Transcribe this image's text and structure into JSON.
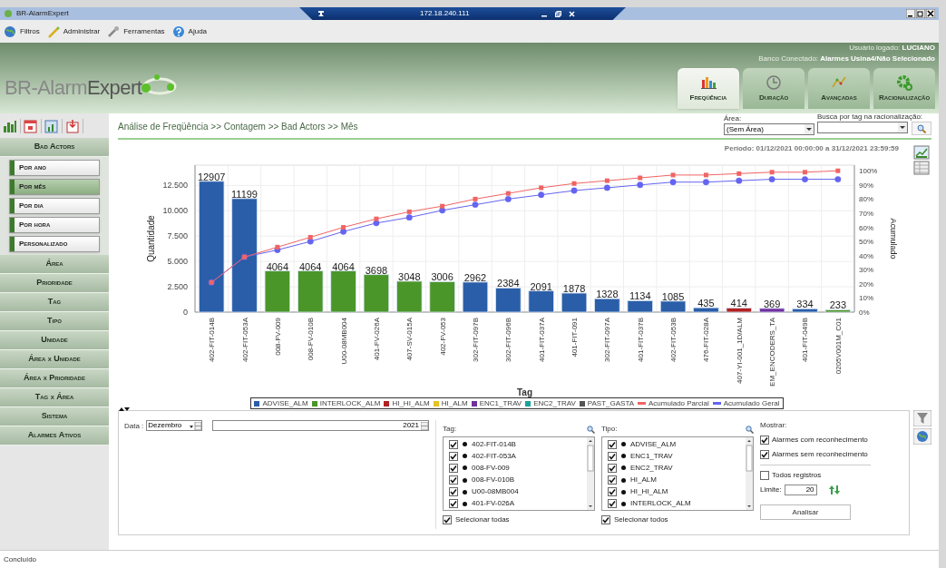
{
  "window": {
    "title": "BR-AlarmExpert",
    "remote_host": "172.18.240.111"
  },
  "menu": [
    {
      "label": "Filtros",
      "kind": "globe"
    },
    {
      "label": "Administrar",
      "kind": "wand"
    },
    {
      "label": "Ferramentas",
      "kind": "wrench"
    },
    {
      "label": "Ajuda",
      "kind": "help"
    }
  ],
  "header": {
    "logo_light": "BR-Alarm",
    "logo_dark": "Expert",
    "user_label": "Usuário logado:",
    "user": "LUCIANO",
    "db_label": "Banco Conectado:",
    "db": "Alarmes Usina4/Não Selecionado",
    "tabs": [
      {
        "label": "Freqüência",
        "kind": "bars",
        "selected": true
      },
      {
        "label": "Duração",
        "kind": "clock",
        "selected": false
      },
      {
        "label": "Avançadas",
        "kind": "trend",
        "selected": false
      },
      {
        "label": "Racionalização",
        "kind": "gear",
        "selected": false
      }
    ]
  },
  "sidebar": {
    "groups": [
      {
        "label": "Bad Actors",
        "children": [
          {
            "label": "Por ano",
            "selected": false
          },
          {
            "label": "Por mês",
            "selected": true
          },
          {
            "label": "Por dia",
            "selected": false
          },
          {
            "label": "Por hora",
            "selected": false
          },
          {
            "label": "Personalizado",
            "selected": false
          }
        ]
      },
      {
        "label": "Área"
      },
      {
        "label": "Prioridade"
      },
      {
        "label": "Tag"
      },
      {
        "label": "Tipo"
      },
      {
        "label": "Unidade"
      },
      {
        "label": "Área x Unidade"
      },
      {
        "label": "Área x Prioridade"
      },
      {
        "label": "Tag x Área"
      },
      {
        "label": "Sistema"
      },
      {
        "label": "Alarmes Ativos"
      }
    ]
  },
  "breadcrumb": "Análise de Freqüência >> Contagem >> Bad Actors >> Mês",
  "area_filter": {
    "label": "Área:",
    "value": "(Sem Área)"
  },
  "search": {
    "label": "Busca por tag na racionalização:"
  },
  "chart": {
    "period": "Período: 01/12/2021 00:00:00 a 31/12/2021 23:59:59",
    "chart_data": {
      "type": "bar",
      "xlabel": "Tag",
      "ylabel": "Quantidade",
      "grid": true,
      "categories": [
        "402-FIT-014B",
        "402-FIT-053A",
        "008-FV-009",
        "008-FV-010B",
        "U00-08MB004",
        "401-FV-026A",
        "407-SV-015A",
        "402-FV-053",
        "302-FIT-097B",
        "302-FIT-096B",
        "401-FIT-037A",
        "401-FIT-091",
        "302-FIT-097A",
        "401-FIT-037B",
        "402-FIT-053B",
        "476-FIT-028A",
        "407-YI-001_1D/ALM",
        "EM_ENCODERS_TA",
        "401-FIT-049B",
        "0205V001M_C01"
      ],
      "ylim": [
        0,
        14500
      ],
      "yticks": [
        {
          "value": 0,
          "label": "0"
        },
        {
          "value": 2500,
          "label": "2.500"
        },
        {
          "value": 5000,
          "label": "5.000"
        },
        {
          "value": 7500,
          "label": "7.500"
        },
        {
          "value": 10000,
          "label": "10.000"
        },
        {
          "value": 12500,
          "label": "12.500"
        }
      ],
      "value_labels": [
        "12907",
        "11199",
        "4064",
        "4064",
        "4064",
        "3698",
        "3048",
        "3006",
        "2962",
        "2384",
        "2091",
        "1878",
        "1328",
        "1134",
        "1085",
        "435",
        "414",
        "369",
        "334",
        "233"
      ],
      "series": [
        {
          "name": "ADVISE_ALM",
          "color": "#2a5ea8",
          "values": [
            12907,
            11199,
            null,
            null,
            null,
            null,
            null,
            null,
            2962,
            2384,
            2091,
            1878,
            1328,
            1134,
            1085,
            435,
            null,
            null,
            334,
            null
          ]
        },
        {
          "name": "INTERLOCK_ALM",
          "color": "#4a9628",
          "values": [
            null,
            null,
            4064,
            4064,
            4064,
            3698,
            3048,
            3006,
            null,
            null,
            null,
            null,
            null,
            null,
            null,
            null,
            null,
            null,
            null,
            233
          ]
        },
        {
          "name": "HI_HI_ALM",
          "color": "#b22222",
          "values": [
            null,
            null,
            null,
            null,
            null,
            null,
            null,
            null,
            null,
            null,
            null,
            null,
            null,
            null,
            null,
            null,
            414,
            null,
            null,
            null
          ]
        },
        {
          "name": "HI_ALM",
          "color": "#e6c422",
          "values": [
            null,
            null,
            null,
            null,
            null,
            null,
            null,
            null,
            null,
            null,
            null,
            null,
            null,
            null,
            null,
            null,
            null,
            null,
            null,
            null
          ]
        },
        {
          "name": "ENC1_TRAV",
          "color": "#7030a0",
          "values": [
            null,
            null,
            null,
            null,
            null,
            null,
            null,
            null,
            null,
            null,
            null,
            null,
            null,
            null,
            null,
            null,
            null,
            369,
            null,
            null
          ]
        },
        {
          "name": "ENC2_TRAV",
          "color": "#1aa39a",
          "values": [
            null,
            null,
            null,
            null,
            null,
            null,
            null,
            null,
            null,
            null,
            null,
            null,
            null,
            null,
            null,
            null,
            null,
            null,
            null,
            null
          ]
        },
        {
          "name": "PAST_GASTA",
          "color": "#555555",
          "values": [
            null,
            null,
            null,
            null,
            null,
            null,
            null,
            null,
            null,
            null,
            null,
            null,
            null,
            null,
            null,
            null,
            null,
            null,
            null,
            null
          ]
        }
      ]
    },
    "cumulative": {
      "chart_data": {
        "type": "line",
        "ylabel": "Acumulado",
        "ylim": [
          0,
          104
        ],
        "yticks": [
          {
            "value": 0,
            "label": "0%"
          },
          {
            "value": 10,
            "label": "10%"
          },
          {
            "value": 20,
            "label": "20%"
          },
          {
            "value": 30,
            "label": "30%"
          },
          {
            "value": 40,
            "label": "40%"
          },
          {
            "value": 50,
            "label": "50%"
          },
          {
            "value": 60,
            "label": "60%"
          },
          {
            "value": 70,
            "label": "70%"
          },
          {
            "value": 80,
            "label": "80%"
          },
          {
            "value": 90,
            "label": "90%"
          },
          {
            "value": 100,
            "label": "100%"
          }
        ],
        "series": [
          {
            "name": "Acumulado Parcial",
            "color": "#f06464",
            "marker": "square",
            "values": [
              21,
              39,
              46,
              53,
              60,
              66,
              71,
              75,
              80,
              84,
              88,
              91,
              93,
              95,
              97,
              97,
              98,
              99,
              99,
              100
            ]
          },
          {
            "name": "Acumulado Geral",
            "color": "#6464f0",
            "marker": "circle",
            "values": [
              21,
              39,
              44,
              50,
              57,
              63,
              67,
              72,
              76,
              80,
              83,
              86,
              88,
              90,
              92,
              92,
              93,
              94,
              94,
              94
            ]
          }
        ]
      }
    }
  },
  "filters": {
    "date_label": "Data :",
    "month": "Dezembro",
    "year": "2021",
    "tag_list": {
      "label": "Tag:",
      "items": [
        {
          "label": "402-FIT-014B",
          "checked": true
        },
        {
          "label": "402-FIT-053A",
          "checked": true
        },
        {
          "label": "008-FV-009",
          "checked": true
        },
        {
          "label": "008-FV-010B",
          "checked": true
        },
        {
          "label": "U00-08MB004",
          "checked": true
        },
        {
          "label": "401-FV-026A",
          "checked": true
        }
      ],
      "select_all": {
        "label": "Selecionar todas",
        "checked": true
      }
    },
    "type_list": {
      "label": "Tipo:",
      "items": [
        {
          "label": "ADVISE_ALM",
          "checked": true
        },
        {
          "label": "ENC1_TRAV",
          "checked": true
        },
        {
          "label": "ENC2_TRAV",
          "checked": true
        },
        {
          "label": "HI_ALM",
          "checked": true
        },
        {
          "label": "HI_HI_ALM",
          "checked": true
        },
        {
          "label": "INTERLOCK_ALM",
          "checked": true
        }
      ],
      "select_all": {
        "label": "Selecionar todos",
        "checked": true
      }
    },
    "show": {
      "label": "Mostrar:",
      "options": [
        {
          "label": "Alarmes com reconhecimento",
          "checked": true
        },
        {
          "label": "Alarmes sem reconhecimento",
          "checked": true
        }
      ]
    },
    "all_records": {
      "label": "Todos registros",
      "checked": false
    },
    "limit": {
      "label": "Limite:",
      "value": "20"
    },
    "button": "Analisar"
  },
  "status_bar": "Concluído"
}
